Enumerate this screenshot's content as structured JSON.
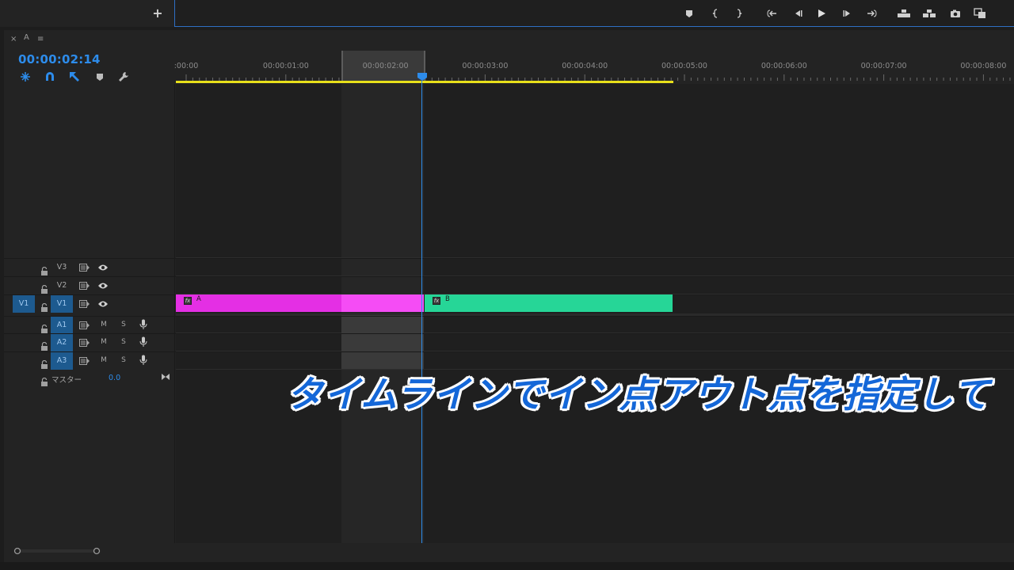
{
  "toolbar": {
    "add_label": "+",
    "transport_icons": [
      "add-marker-icon",
      "mark-in-icon",
      "mark-out-icon",
      "go-to-in-icon",
      "step-back-icon",
      "play-icon",
      "step-forward-icon",
      "go-to-out-icon",
      "lift-icon",
      "extract-icon",
      "export-frame-icon",
      "compare-view-icon"
    ]
  },
  "panel": {
    "close_label": "×",
    "tab_label": "A",
    "menu_label": "≡"
  },
  "timecode": "00:00:02:14",
  "ruler": {
    "labels": [
      ":00:00",
      "00:00:01:00",
      "00:00:02:00",
      "00:00:03:00",
      "00:00:04:00",
      "00:00:05:00",
      "00:00:06:00",
      "00:00:07:00",
      "00:00:08:00"
    ]
  },
  "tracks": {
    "video": [
      {
        "name": "V3"
      },
      {
        "name": "V2"
      },
      {
        "name": "V1",
        "source": "V1"
      }
    ],
    "audio": [
      {
        "name": "A1",
        "mute": "M",
        "solo": "S"
      },
      {
        "name": "A2",
        "mute": "M",
        "solo": "S"
      },
      {
        "name": "A3",
        "mute": "M",
        "solo": "S"
      }
    ],
    "master": {
      "name": "マスター",
      "value": "0.0"
    }
  },
  "clips": [
    {
      "label": "A",
      "color": "#e42fe4"
    },
    {
      "label": "B",
      "color": "#26d697"
    }
  ],
  "caption": "タイムラインでイン点アウト点を指定して",
  "colors": {
    "accent": "#2d8ceb",
    "workarea": "#e8e01a",
    "track_target": "#1d5a8f"
  }
}
